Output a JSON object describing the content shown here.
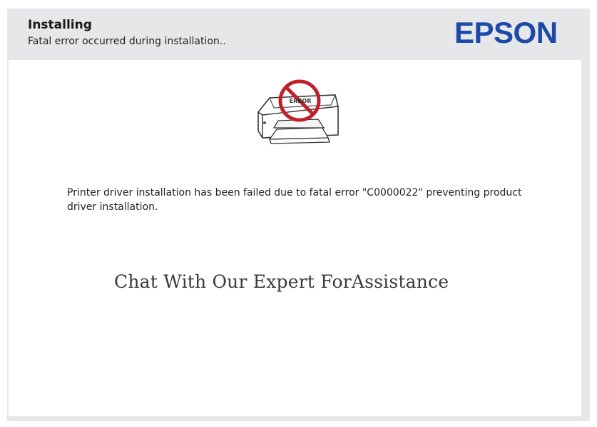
{
  "header": {
    "title": "Installing",
    "subtitle": "Fatal error occurred during installation.."
  },
  "brand": {
    "logo_text": "EPSON",
    "color": "#1d4aa8"
  },
  "illustration": {
    "icon": "printer-error-icon",
    "badge_text": "ERROR",
    "badge_color": "#c0202a"
  },
  "main": {
    "error_message": "Printer driver installation has been failed due to fatal error \"C0000022\" preventing product driver installation.",
    "assistance_text": "Chat With Our Expert ForAssistance"
  }
}
